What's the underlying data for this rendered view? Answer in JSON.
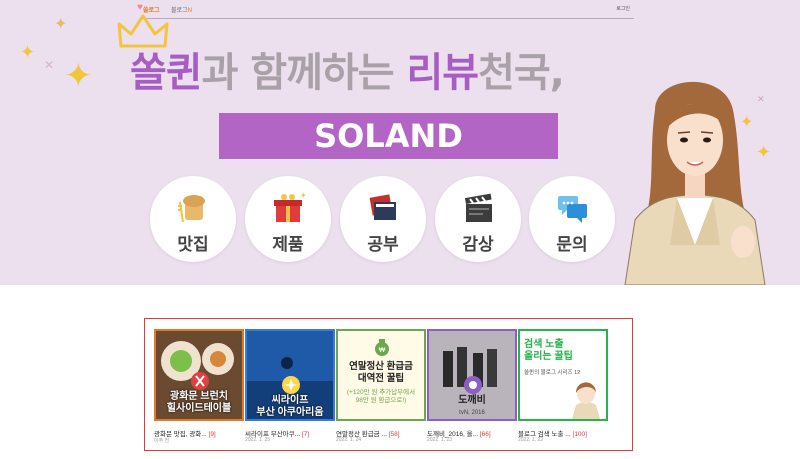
{
  "topbar": {
    "brand": "쏠로그",
    "nav_link": "블로그",
    "nav_new": "N",
    "login": "로그인"
  },
  "headline": {
    "part1": "쏠퀸",
    "part2": "과 함께하는 ",
    "part3": "리뷰",
    "part4": "천국,"
  },
  "banner_title": "SOLAND",
  "categories": [
    {
      "label": "맛집",
      "icon": "bread-icon"
    },
    {
      "label": "제품",
      "icon": "gift-icon"
    },
    {
      "label": "공부",
      "icon": "books-icon"
    },
    {
      "label": "감상",
      "icon": "clapperboard-icon"
    },
    {
      "label": "문의",
      "icon": "chat-bubble-icon"
    }
  ],
  "posts": [
    {
      "caption": "광화문 브런치\n힐사이드테이블",
      "title": "광화문 맛집, 광화...",
      "count": "[9]",
      "date": "이주 전",
      "border": "#e07a26"
    },
    {
      "caption": "씨라이프\n부산 아쿠아리움",
      "title": "씨라이프 부산아쿠...",
      "count": "[7]",
      "date": "2022. 1. 25",
      "border": "#3a7bd5"
    },
    {
      "caption": "연말정산 환급금\n대역전 꿀팁",
      "subcaption": "(+120만 원 추가납부에서\n98만 원 환급으로!)",
      "title": "연말정산 환급금 ...",
      "count": "[58]",
      "date": "2022. 1. 24",
      "border": "#6aa84f"
    },
    {
      "caption": "도깨비",
      "subcaption": "tvN, 2016",
      "title": "도깨비_2016, 을...",
      "count": "[66]",
      "date": "2022. 1. 23",
      "border": "#8e5fc2"
    },
    {
      "caption": "검색 노출\n올리는 꿀팁",
      "subcaption": "쏠퀸의 블로그 시리즈 12",
      "title": "블로그 검색 노출 ...",
      "count": "[100]",
      "date": "2022. 1. 22",
      "border": "#27b24a"
    }
  ],
  "colors": {
    "banner_bg": "#ecdfee",
    "accent_purple": "#b365c5",
    "headline_purple": "#a75ec4",
    "headline_gray": "#a8a2a8",
    "gallery_border": "#e03a3a",
    "count_red": "#e03a3a"
  }
}
